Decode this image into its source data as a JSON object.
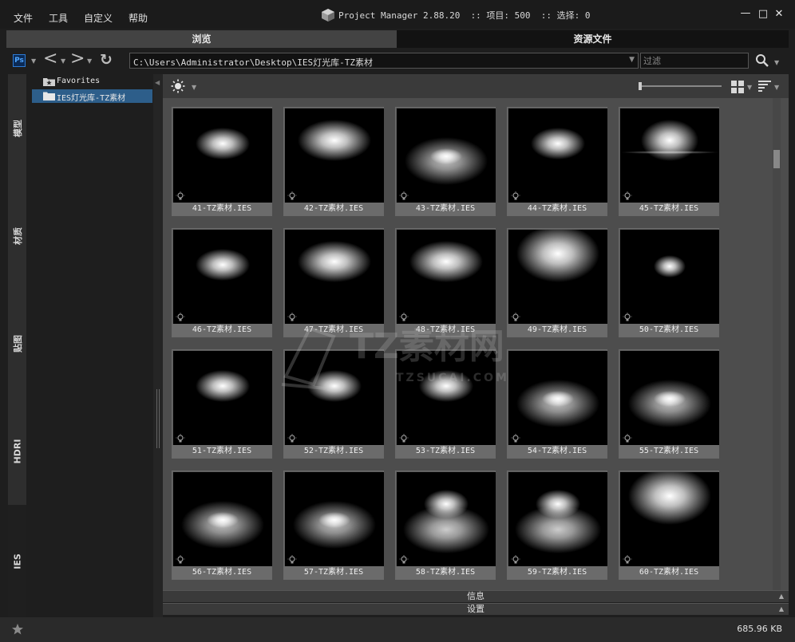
{
  "titlebar": {
    "menu": [
      "文件",
      "工具",
      "自定义",
      "帮助"
    ],
    "app_title": "Project Manager 2.88.20  :: 项目: 500  :: 选择: 0",
    "min_symbol": "—",
    "max_symbol": "□",
    "close_symbol": "✕"
  },
  "tabs": {
    "browse": "浏览",
    "assets": "资源文件"
  },
  "address": {
    "ps_label": "Ps",
    "path": "C:\\Users\\Administrator\\Desktop\\IES灯光库-TZ素材",
    "filter_placeholder": "过滤",
    "back_symbol": "<",
    "forward_symbol": ">",
    "refresh_symbol": "↻"
  },
  "vertical_tabs": [
    "模型",
    "材质",
    "贴图",
    "HDRI",
    "IES"
  ],
  "tree": {
    "favorites": "Favorites",
    "folder": "IES灯光库-TZ素材"
  },
  "toolbar": {
    "zoom_level": 0.0
  },
  "thumbnails": [
    {
      "label": "41-TZ素材.IES",
      "glow": "soft-top"
    },
    {
      "label": "42-TZ素材.IES",
      "glow": "wide-top"
    },
    {
      "label": "43-TZ素材.IES",
      "glow": "cone-down"
    },
    {
      "label": "44-TZ素材.IES",
      "glow": "soft-top"
    },
    {
      "label": "45-TZ素材.IES",
      "glow": "flare-top"
    },
    {
      "label": "46-TZ素材.IES",
      "glow": "soft-top"
    },
    {
      "label": "47-TZ素材.IES",
      "glow": "wide-top"
    },
    {
      "label": "48-TZ素材.IES",
      "glow": "wide-top"
    },
    {
      "label": "49-TZ素材.IES",
      "glow": "big-top"
    },
    {
      "label": "50-TZ素材.IES",
      "glow": "small-top"
    },
    {
      "label": "51-TZ素材.IES",
      "glow": "soft-top"
    },
    {
      "label": "52-TZ素材.IES",
      "glow": "soft-top"
    },
    {
      "label": "53-TZ素材.IES",
      "glow": "soft-top"
    },
    {
      "label": "54-TZ素材.IES",
      "glow": "cone-down"
    },
    {
      "label": "55-TZ素材.IES",
      "glow": "cone-down"
    },
    {
      "label": "56-TZ素材.IES",
      "glow": "cone-down"
    },
    {
      "label": "57-TZ素材.IES",
      "glow": "cone-down"
    },
    {
      "label": "58-TZ素材.IES",
      "glow": "double"
    },
    {
      "label": "59-TZ素材.IES",
      "glow": "double"
    },
    {
      "label": "60-TZ素材.IES",
      "glow": "big-top"
    }
  ],
  "watermark": {
    "brand": "TZ素材网",
    "site": "TZSUCAI.COM"
  },
  "panels": {
    "info": "信息",
    "settings": "设置"
  },
  "status": {
    "size": "685.96 KB"
  }
}
